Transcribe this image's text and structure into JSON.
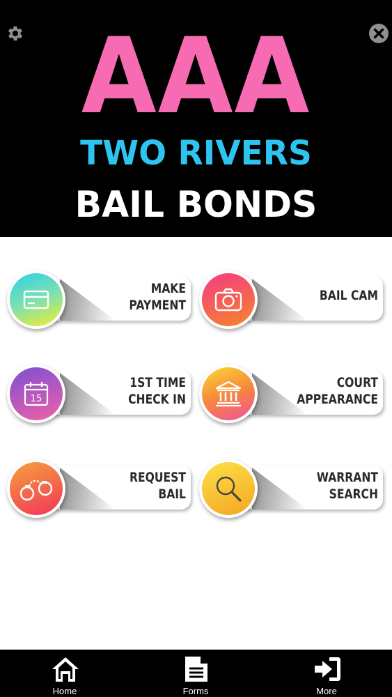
{
  "header": {
    "logo_line1": "AAA",
    "logo_line2": "TWO RIVERS",
    "logo_line3": "BAIL BONDS",
    "colors": {
      "line1": "#f76bb3",
      "line2": "#2fc4ef",
      "line3": "#ffffff",
      "background": "#000000"
    },
    "left_icon": "gear-icon",
    "right_icon": "close-circle-icon"
  },
  "tiles": [
    {
      "label_line1": "MAKE",
      "label_line2": "PAYMENT",
      "icon": "credit-card-icon",
      "gradient": [
        "#2fd0e8",
        "#f4ee2a"
      ]
    },
    {
      "label_line1": "BAIL CAM",
      "label_line2": "",
      "icon": "camera-icon",
      "gradient": [
        "#f33b83",
        "#f7852c"
      ]
    },
    {
      "label_line1": "1ST TIME",
      "label_line2": "CHECK IN",
      "icon": "calendar-icon",
      "icon_text": "15",
      "gradient": [
        "#7c4fd4",
        "#f062a6"
      ]
    },
    {
      "label_line1": "COURT",
      "label_line2": "APPEARANCE",
      "icon": "courthouse-icon",
      "gradient": [
        "#fbd834",
        "#f04fa0"
      ]
    },
    {
      "label_line1": "REQUEST",
      "label_line2": "BAIL",
      "icon": "handcuffs-icon",
      "gradient": [
        "#f5a13a",
        "#f1355b"
      ]
    },
    {
      "label_line1": "WARRANT",
      "label_line2": "SEARCH",
      "icon": "magnifier-icon",
      "gradient": [
        "#fde047",
        "#f5a623"
      ]
    }
  ],
  "nav": [
    {
      "label": "Home",
      "icon": "home-icon"
    },
    {
      "label": "Forms",
      "icon": "document-icon"
    },
    {
      "label": "More",
      "icon": "sign-in-icon"
    }
  ]
}
